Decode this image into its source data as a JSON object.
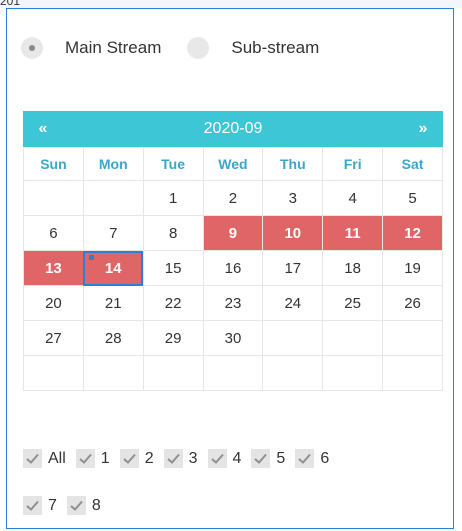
{
  "top_label": "201",
  "stream": {
    "options": [
      {
        "label": "Main Stream",
        "selected": true
      },
      {
        "label": "Sub-stream",
        "selected": false
      }
    ]
  },
  "calendar": {
    "title": "2020-09",
    "prev_label": "«",
    "next_label": "»",
    "weekdays": [
      "Sun",
      "Mon",
      "Tue",
      "Wed",
      "Thu",
      "Fri",
      "Sat"
    ],
    "weeks": [
      [
        "",
        "",
        "1",
        "2",
        "3",
        "4",
        "5"
      ],
      [
        "6",
        "7",
        "8",
        "9",
        "10",
        "11",
        "12"
      ],
      [
        "13",
        "14",
        "15",
        "16",
        "17",
        "18",
        "19"
      ],
      [
        "20",
        "21",
        "22",
        "23",
        "24",
        "25",
        "26"
      ],
      [
        "27",
        "28",
        "29",
        "30",
        "",
        "",
        ""
      ],
      [
        "",
        "",
        "",
        "",
        "",
        "",
        ""
      ]
    ],
    "recorded_days": [
      "9",
      "10",
      "11",
      "12",
      "13",
      "14"
    ],
    "selected_day": "14",
    "header_color": "#3cc6d6",
    "recorded_color": "#e06566",
    "selected_outline_color": "#2b7fd4"
  },
  "channels": {
    "items": [
      {
        "label": "All",
        "checked": true
      },
      {
        "label": "1",
        "checked": true
      },
      {
        "label": "2",
        "checked": true
      },
      {
        "label": "3",
        "checked": true
      },
      {
        "label": "4",
        "checked": true
      },
      {
        "label": "5",
        "checked": true
      },
      {
        "label": "6",
        "checked": true
      },
      {
        "label": "7",
        "checked": true
      },
      {
        "label": "8",
        "checked": true
      }
    ]
  }
}
